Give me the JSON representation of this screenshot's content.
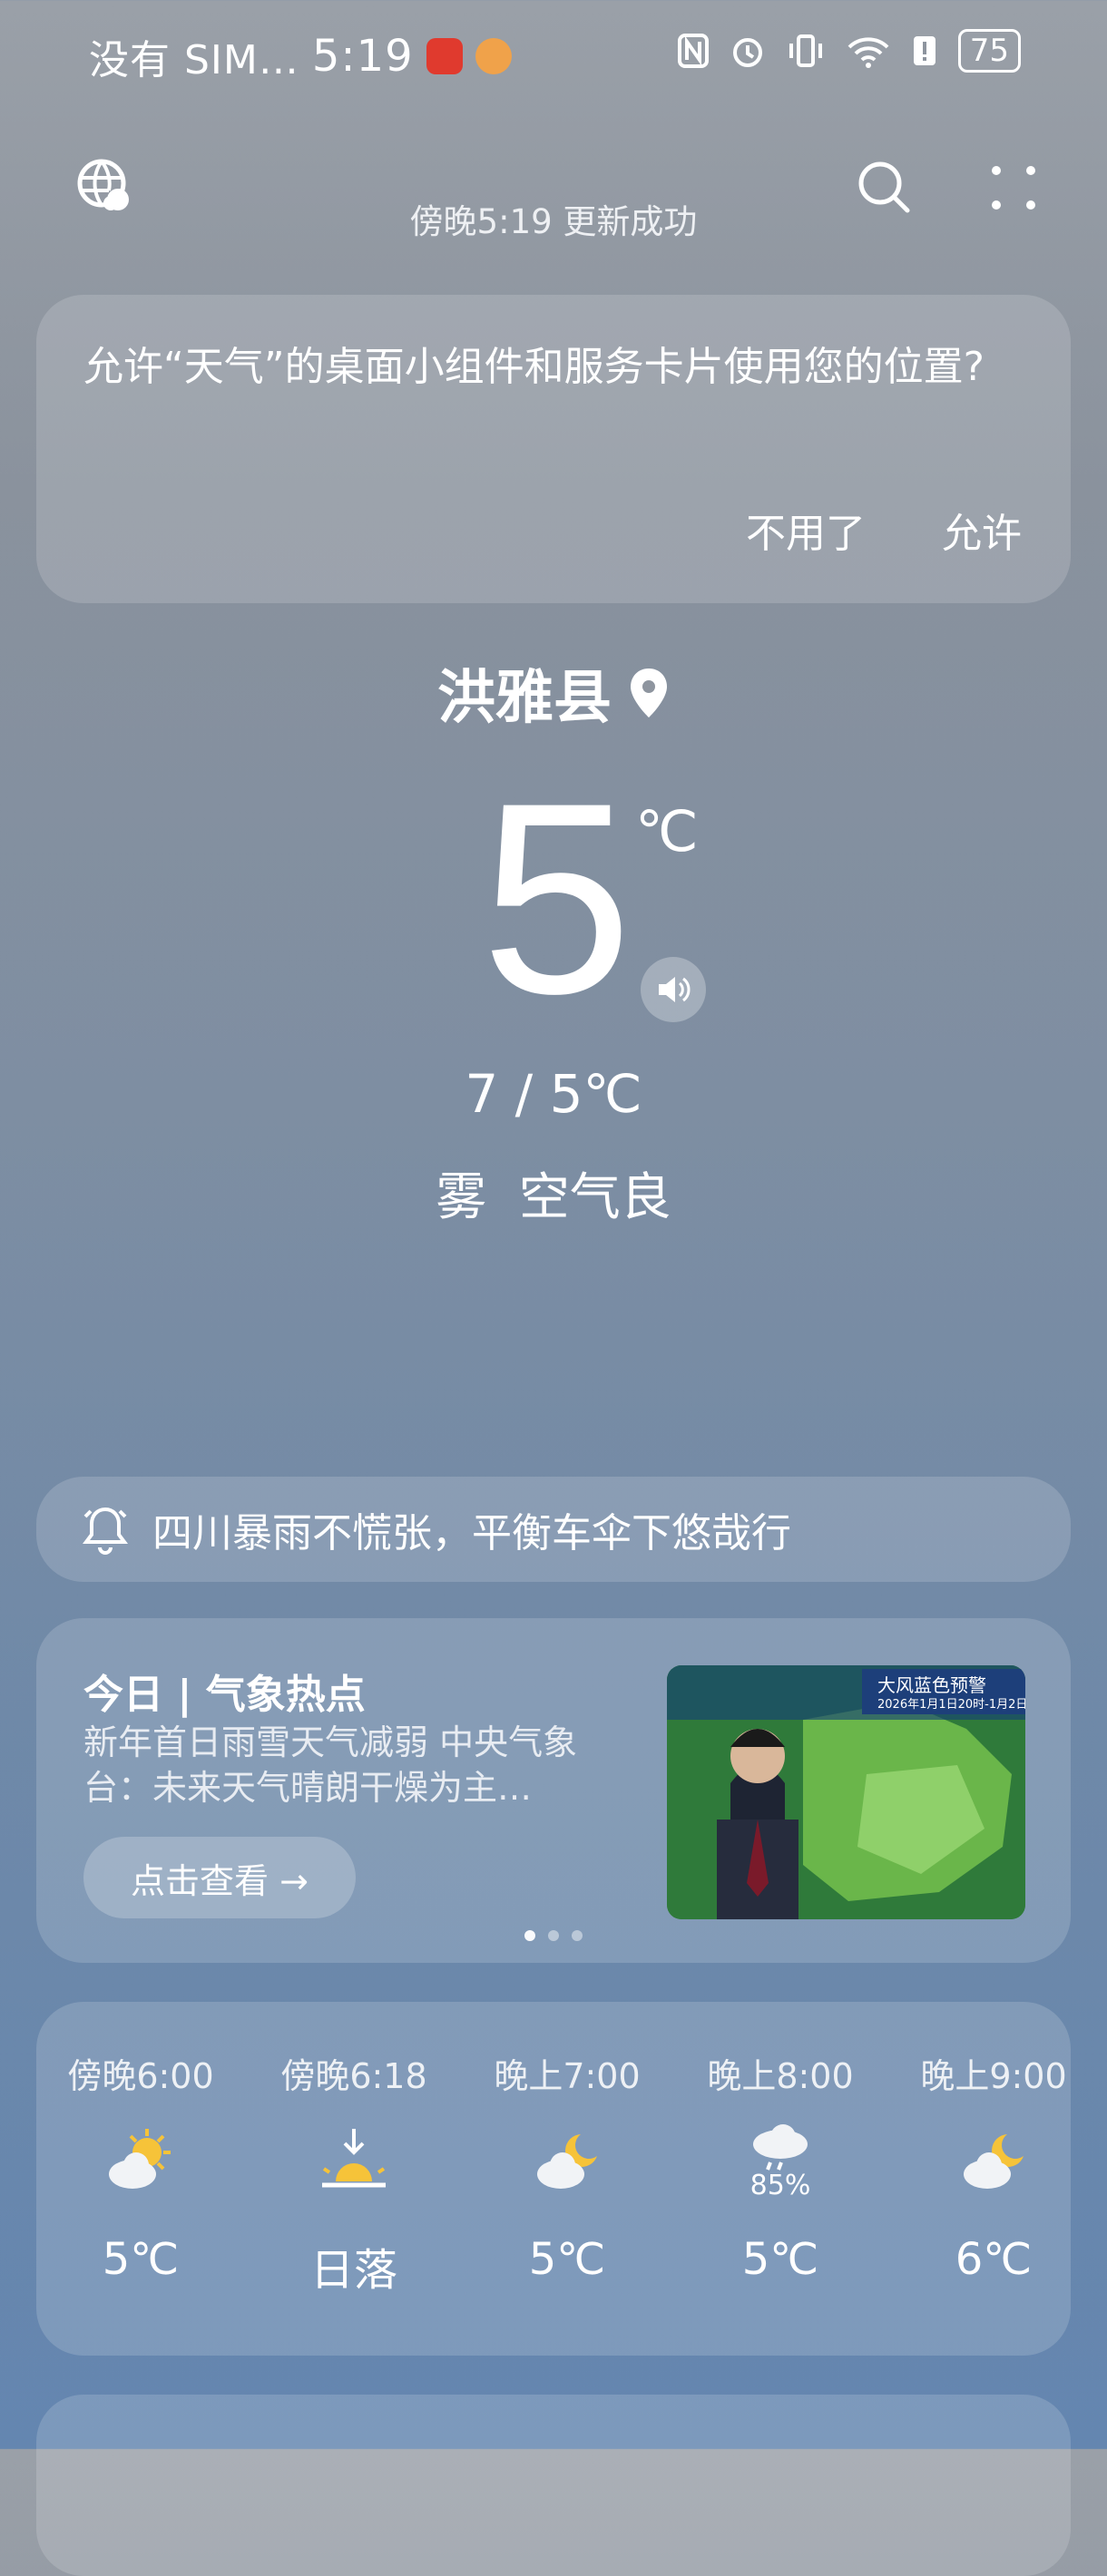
{
  "status_bar": {
    "carrier": "没有 SIM…",
    "time": "5:19",
    "battery": "75"
  },
  "header": {
    "update_text": "傍晚5:19 更新成功"
  },
  "permission": {
    "message": "允许“天气”的桌面小组件和服务卡片使用您的位置?",
    "deny_label": "不用了",
    "allow_label": "允许"
  },
  "current": {
    "location": "洪雅县",
    "temperature": "5",
    "unit": "℃",
    "range": "7 / 5℃",
    "condition": "雾  空气良"
  },
  "alert": {
    "text": "四川暴雨不慌张，平衡车伞下悠哉行"
  },
  "news": {
    "title": "今日 | 气象热点",
    "subtitle": "新年首日雨雪天气减弱 中央气象台：未来天气晴朗干燥为主…",
    "button_label": "点击查看 →",
    "image_banner": "大风蓝色预警",
    "image_date": "2026年1月1日20时-1月2日"
  },
  "hourly": [
    {
      "time": "傍晚6:00",
      "icon": "partly-cloudy-day-icon",
      "value": "5℃"
    },
    {
      "time": "傍晚6:18",
      "icon": "sunset-icon",
      "value": "日落"
    },
    {
      "time": "晚上7:00",
      "icon": "partly-cloudy-night-icon",
      "value": "5℃"
    },
    {
      "time": "晚上8:00",
      "icon": "rain-cloud-icon",
      "precip": "85%",
      "value": "5℃"
    },
    {
      "time": "晚上9:00",
      "icon": "partly-cloudy-night-icon",
      "value": "6℃"
    }
  ]
}
